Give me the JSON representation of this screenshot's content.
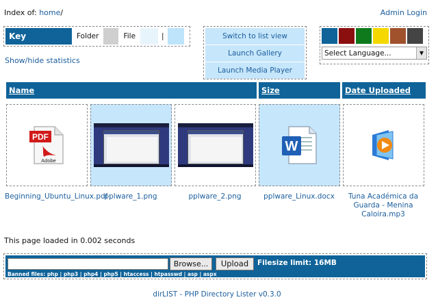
{
  "header": {
    "index_prefix": "Index of:",
    "home_link": "home",
    "path_suffix": "/",
    "admin_login": "Admin Login"
  },
  "key": {
    "title": "Key",
    "folder_label": "Folder",
    "file_label": "File",
    "separator": "|",
    "colors": {
      "folder": "#cfcfcf",
      "file": "#e8f4fc",
      "file_highlight": "#bde4fb"
    }
  },
  "stats_link": "Show/hide statistics",
  "view_buttons": {
    "list_view": "Switch to list view",
    "gallery": "Launch Gallery",
    "media_player": "Launch Media Player"
  },
  "theme": {
    "swatches": [
      "#0f6399",
      "#8b0f0f",
      "#0f7a1c",
      "#f5d800",
      "#a0522d",
      "#444444"
    ],
    "language_select": "Select Language..."
  },
  "columns": {
    "name": "Name",
    "size": "Size",
    "date": "Date Uploaded"
  },
  "files": [
    {
      "name": "Beginning_Ubuntu_Linux.pdf",
      "icon": "pdf-icon"
    },
    {
      "name": "pplware_1.png",
      "icon": "image-thumbnail"
    },
    {
      "name": "pplware_2.png",
      "icon": "image-thumbnail"
    },
    {
      "name": "pplware_Linux.docx",
      "icon": "word-doc-icon"
    },
    {
      "name": "Tuna Académica da Guarda - Menina Caloira.mp3",
      "icon": "media-player-icon"
    }
  ],
  "load_time": "This page loaded in 0.002 seconds",
  "upload": {
    "browse": "Browse...",
    "upload": "Upload",
    "size_limit": "Filesize limit: 16MB",
    "banned": "Banned files: php | php3 | php4 | php5 | htaccess | htpasswd | asp | aspx"
  },
  "footer": "dirLIST - PHP Directory Lister v0.3.0",
  "colors": {
    "accent": "#0f6399",
    "tile_highlight": "#c6e6fb",
    "link": "#1a5d9c"
  }
}
